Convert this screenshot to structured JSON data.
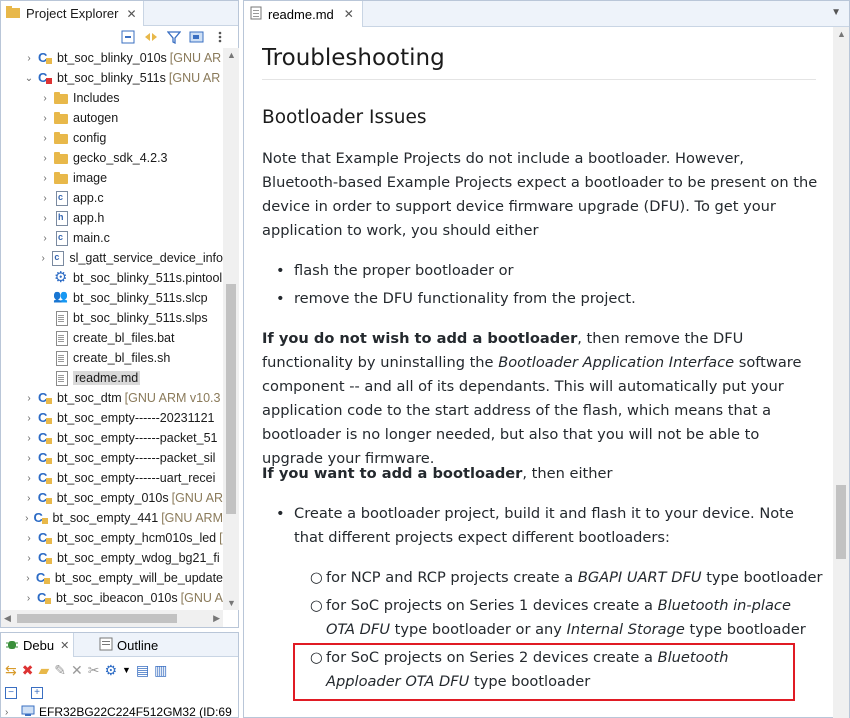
{
  "explorer": {
    "title": "Project Explorer",
    "tree": [
      {
        "label": "bt_soc_blinky_010s",
        "deco": "[GNU AR",
        "icon": "project",
        "chev": "›",
        "indent": 0
      },
      {
        "label": "bt_soc_blinky_511s",
        "deco": "[GNU AR",
        "icon": "project-err",
        "chev": "⌄",
        "indent": 0
      },
      {
        "label": "Includes",
        "deco": "",
        "icon": "folder",
        "chev": "›",
        "indent": 1
      },
      {
        "label": "autogen",
        "deco": "",
        "icon": "folder",
        "chev": "›",
        "indent": 1
      },
      {
        "label": "config",
        "deco": "",
        "icon": "folder",
        "chev": "›",
        "indent": 1
      },
      {
        "label": "gecko_sdk_4.2.3",
        "deco": "",
        "icon": "folder",
        "chev": "›",
        "indent": 1
      },
      {
        "label": "image",
        "deco": "",
        "icon": "folder",
        "chev": "›",
        "indent": 1
      },
      {
        "label": "app.c",
        "deco": "",
        "icon": "file-c",
        "chev": "›",
        "indent": 1
      },
      {
        "label": "app.h",
        "deco": "",
        "icon": "file-h",
        "chev": "›",
        "indent": 1
      },
      {
        "label": "main.c",
        "deco": "",
        "icon": "file-c",
        "chev": "›",
        "indent": 1
      },
      {
        "label": "sl_gatt_service_device_info",
        "deco": "",
        "icon": "file-c",
        "chev": "›",
        "indent": 1
      },
      {
        "label": "bt_soc_blinky_511s.pintool",
        "deco": "",
        "icon": "gear",
        "chev": "",
        "indent": 1
      },
      {
        "label": "bt_soc_blinky_511s.slcp",
        "deco": "",
        "icon": "people",
        "chev": "",
        "indent": 1
      },
      {
        "label": "bt_soc_blinky_511s.slps",
        "deco": "",
        "icon": "doc",
        "chev": "",
        "indent": 1
      },
      {
        "label": "create_bl_files.bat",
        "deco": "",
        "icon": "doc",
        "chev": "",
        "indent": 1
      },
      {
        "label": "create_bl_files.sh",
        "deco": "",
        "icon": "doc",
        "chev": "",
        "indent": 1
      },
      {
        "label": "readme.md",
        "deco": "",
        "icon": "doc",
        "chev": "",
        "indent": 1,
        "selected": true
      },
      {
        "label": "bt_soc_dtm",
        "deco": "[GNU ARM v10.3",
        "icon": "project",
        "chev": "›",
        "indent": 0
      },
      {
        "label": "bt_soc_empty------20231121",
        "deco": "",
        "icon": "project",
        "chev": "›",
        "indent": 0
      },
      {
        "label": "bt_soc_empty------packet_51",
        "deco": "",
        "icon": "project",
        "chev": "›",
        "indent": 0
      },
      {
        "label": "bt_soc_empty------packet_sil",
        "deco": "",
        "icon": "project",
        "chev": "›",
        "indent": 0
      },
      {
        "label": "bt_soc_empty------uart_recei",
        "deco": "",
        "icon": "project",
        "chev": "›",
        "indent": 0
      },
      {
        "label": "bt_soc_empty_010s",
        "deco": "[GNU AR",
        "icon": "project",
        "chev": "›",
        "indent": 0
      },
      {
        "label": "bt_soc_empty_441",
        "deco": "[GNU ARM",
        "icon": "project",
        "chev": "›",
        "indent": 0
      },
      {
        "label": "bt_soc_empty_hcm010s_led",
        "deco": "[",
        "icon": "project",
        "chev": "›",
        "indent": 0
      },
      {
        "label": "bt_soc_empty_wdog_bg21_fi",
        "deco": "",
        "icon": "project",
        "chev": "›",
        "indent": 0
      },
      {
        "label": "bt_soc_empty_will_be_update",
        "deco": "",
        "icon": "project",
        "chev": "›",
        "indent": 0
      },
      {
        "label": "bt_soc_ibeacon_010s",
        "deco": "[GNU A",
        "icon": "project",
        "chev": "›",
        "indent": 0
      }
    ]
  },
  "debug": {
    "tabs": [
      {
        "label": "Debu",
        "close": "✕"
      },
      {
        "label": "Outline",
        "close": ""
      }
    ],
    "device": "EFR32BG22C224F512GM32 (ID:69"
  },
  "editor": {
    "tab_label": "readme.md",
    "h1": "Troubleshooting",
    "h2": "Bootloader Issues",
    "p1": "Note that Example Projects do not include a bootloader. However, Bluetooth-based Example Projects expect a bootloader to be present on the device in order to support device firmware upgrade (DFU). To get your application to work, you should either",
    "b1": "flash the proper bootloader or",
    "b2": "remove the DFU functionality from the project.",
    "p2_bold": "If you do not wish to add a bootloader",
    "p2_a": ", then remove the DFU functionality by uninstalling the ",
    "p2_em": "Bootloader Application Interface",
    "p2_b": " software component -- and all of its dependants. This will automatically put your application code to the start address of the flash, which means that a bootloader is no longer needed, but also that you will not be able to upgrade your firmware.",
    "p3_bold": "If you want to add a bootloader",
    "p3_a": ", then either",
    "b3": "Create a bootloader project, build it and flash it to your device. Note that different projects expect different bootloaders:",
    "s1_a": "for NCP and RCP projects create a ",
    "s1_em": "BGAPI UART DFU",
    "s1_b": " type bootloader",
    "s2_a": "for SoC projects on Series 1 devices create a ",
    "s2_em1": "Bluetooth in-place OTA DFU",
    "s2_b": " type bootloader or any ",
    "s2_em2": "Internal Storage",
    "s2_c": " type bootloader",
    "s3_a": "for SoC projects on Series 2 devices create a ",
    "s3_em": "Bluetooth Apploader OTA DFU",
    "s3_b": " type bootloader"
  }
}
